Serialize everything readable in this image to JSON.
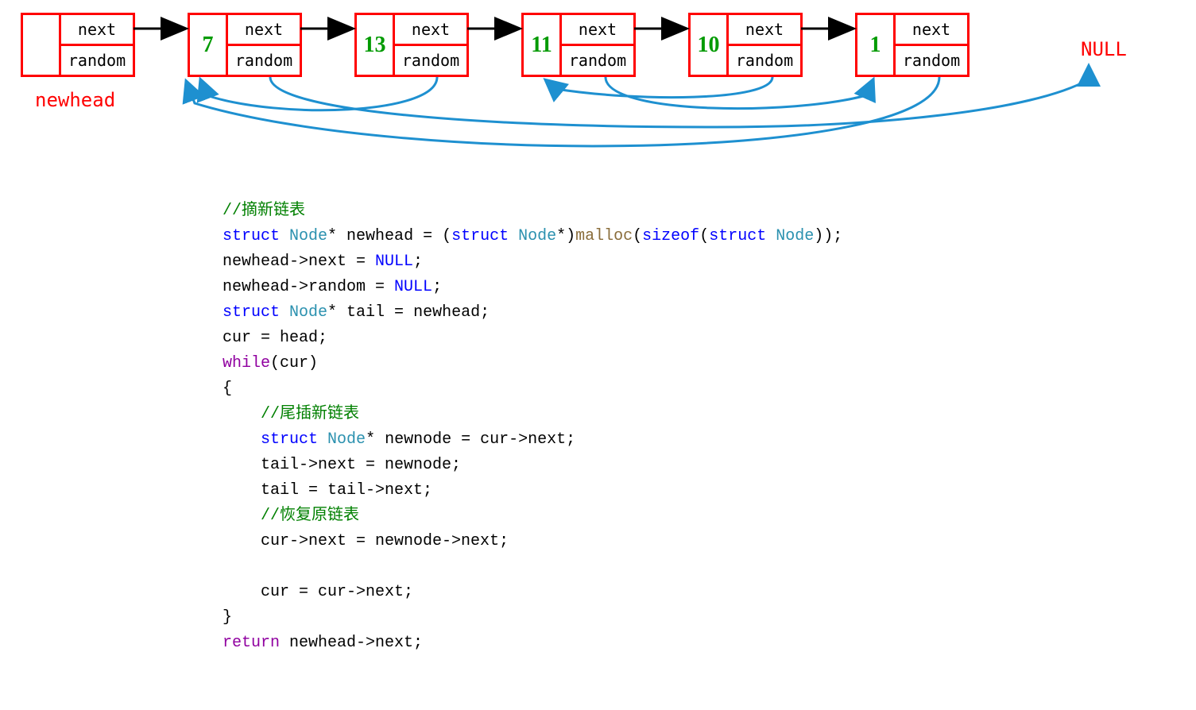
{
  "diagram": {
    "nodes": [
      {
        "val": "",
        "top": "next",
        "bottom": "random"
      },
      {
        "val": "7",
        "top": "next",
        "bottom": "random"
      },
      {
        "val": "13",
        "top": "next",
        "bottom": "random"
      },
      {
        "val": "11",
        "top": "next",
        "bottom": "random"
      },
      {
        "val": "10",
        "top": "next",
        "bottom": "random"
      },
      {
        "val": "1",
        "top": "next",
        "bottom": "random"
      }
    ],
    "newhead_label": "newhead",
    "null_label": "NULL",
    "random_pointers_note": "random pointers: 7->NULL(→right), 13->7, 11->1, 10->11, 1->7"
  },
  "code": {
    "lines": [
      {
        "t": "comment",
        "text": "//摘新链表"
      },
      {
        "t": "line",
        "tokens": [
          [
            "kw-blue",
            "struct"
          ],
          [
            "",
            " "
          ],
          [
            "type",
            "Node"
          ],
          [
            "",
            "* newhead = ("
          ],
          [
            "kw-blue",
            "struct"
          ],
          [
            "",
            " "
          ],
          [
            "type",
            "Node"
          ],
          [
            "",
            "*)"
          ],
          [
            "func",
            "malloc"
          ],
          [
            "",
            "("
          ],
          [
            "kw-blue",
            "sizeof"
          ],
          [
            "",
            "("
          ],
          [
            "kw-blue",
            "struct"
          ],
          [
            "",
            " "
          ],
          [
            "type",
            "Node"
          ],
          [
            "",
            "));"
          ]
        ]
      },
      {
        "t": "line",
        "tokens": [
          [
            "",
            "newhead->next = "
          ],
          [
            "lit",
            "NULL"
          ],
          [
            "",
            ";"
          ]
        ]
      },
      {
        "t": "line",
        "tokens": [
          [
            "",
            "newhead->random = "
          ],
          [
            "lit",
            "NULL"
          ],
          [
            "",
            ";"
          ]
        ]
      },
      {
        "t": "line",
        "tokens": [
          [
            "kw-blue",
            "struct"
          ],
          [
            "",
            " "
          ],
          [
            "type",
            "Node"
          ],
          [
            "",
            "* tail = newhead;"
          ]
        ]
      },
      {
        "t": "line",
        "tokens": [
          [
            "",
            "cur = head;"
          ]
        ]
      },
      {
        "t": "line",
        "tokens": [
          [
            "kw-purple",
            "while"
          ],
          [
            "",
            "(cur)"
          ]
        ]
      },
      {
        "t": "line",
        "tokens": [
          [
            "",
            "{"
          ]
        ]
      },
      {
        "t": "line",
        "indent": 1,
        "tokens": [
          [
            "comment",
            "//尾插新链表"
          ]
        ]
      },
      {
        "t": "line",
        "indent": 1,
        "tokens": [
          [
            "kw-blue",
            "struct"
          ],
          [
            "",
            " "
          ],
          [
            "type",
            "Node"
          ],
          [
            "",
            "* newnode = cur->next;"
          ]
        ]
      },
      {
        "t": "line",
        "indent": 1,
        "tokens": [
          [
            "",
            "tail->next = newnode;"
          ]
        ]
      },
      {
        "t": "line",
        "indent": 1,
        "tokens": [
          [
            "",
            "tail = tail->next;"
          ]
        ]
      },
      {
        "t": "line",
        "indent": 1,
        "tokens": [
          [
            "comment",
            "//恢复原链表"
          ]
        ]
      },
      {
        "t": "line",
        "indent": 1,
        "tokens": [
          [
            "",
            "cur->next = newnode->next;"
          ]
        ]
      },
      {
        "t": "blank"
      },
      {
        "t": "line",
        "indent": 1,
        "tokens": [
          [
            "",
            "cur = cur->next;"
          ]
        ]
      },
      {
        "t": "line",
        "tokens": [
          [
            "",
            "}"
          ]
        ]
      },
      {
        "t": "line",
        "tokens": [
          [
            "kw-purple",
            "return"
          ],
          [
            "",
            " newhead->next;"
          ]
        ]
      }
    ]
  }
}
